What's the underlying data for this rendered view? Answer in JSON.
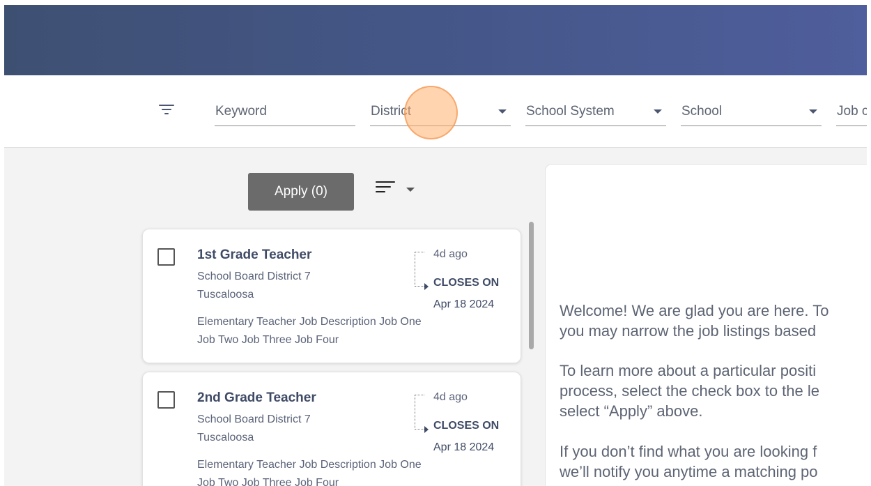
{
  "filters": {
    "keyword": "Keyword",
    "district": "District",
    "school_system": "School System",
    "school": "School",
    "job": "Job c"
  },
  "actions": {
    "apply_label": "Apply (0)"
  },
  "jobs": [
    {
      "title": "1st Grade Teacher",
      "district": "School Board District 7",
      "city": "Tuscaloosa",
      "description": "Elementary Teacher Job Description Job One Job Two Job Three Job Four",
      "posted": "4d ago",
      "closes_label": "CLOSES ON",
      "closes_date": "Apr 18 2024"
    },
    {
      "title": "2nd Grade Teacher",
      "district": "School Board District 7",
      "city": "Tuscaloosa",
      "description": "Elementary Teacher Job Description Job One Job Two Job Three Job Four",
      "posted": "4d ago",
      "closes_label": "CLOSES ON",
      "closes_date": "Apr 18 2024"
    }
  ],
  "welcome": {
    "line1": "Welcome! We are glad you are here. To",
    "line2": "you may narrow the job listings based",
    "line3": "To learn more about a particular positi",
    "line4": "process, select the check box to the le",
    "line5": "select “Apply” above.",
    "line6": "If you don’t find what you are looking f",
    "line7": "we’ll notify you anytime a matching po"
  },
  "colors": {
    "banner_start": "#3e5072",
    "banner_end": "#4f5e9c",
    "apply_button": "#6b6b6b",
    "text_primary": "#3f4b66"
  }
}
